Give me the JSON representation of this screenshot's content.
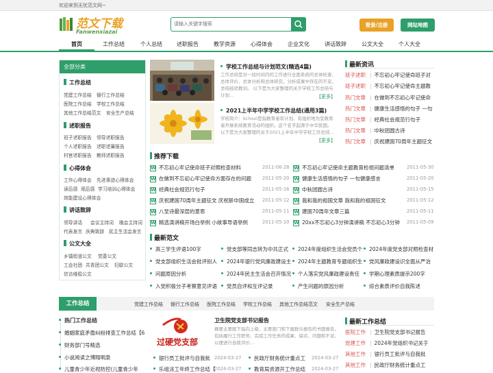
{
  "topbar": {
    "welcome": "欢迎来到无忧范文网~"
  },
  "logo": {
    "cn": "范文下载",
    "en": "Fanwenxiazai"
  },
  "search": {
    "placeholder": "请输入关键字搜索"
  },
  "header": {
    "login": "登录/注册",
    "sitemap": "网站地图"
  },
  "nav": [
    "首页",
    "工作总结",
    "个人总结",
    "述职报告",
    "教学资源",
    "心得体会",
    "企业文化",
    "讲话致辞",
    "公文大全",
    "个人大全"
  ],
  "sidebar": {
    "title": "全部分类",
    "groups": [
      {
        "name": "工作总结",
        "items": [
          [
            "党建工作总结",
            "银行工作总结"
          ],
          [
            "医院工作总结",
            "学校工作总结"
          ],
          [
            "其他工作总结范文",
            "安全生产总结"
          ]
        ]
      },
      {
        "name": "述职报告",
        "items": [
          [
            "班子述职报告",
            "领导述职报告"
          ],
          [
            "个人述职报告",
            "述职述廉报告"
          ],
          [
            "村官述职报告",
            "教师述职报告"
          ]
        ]
      },
      {
        "name": "心得体会",
        "items": [
          [
            "工作心得体会",
            "先进事迹心得体会"
          ],
          [
            "读后感",
            "观后感",
            "学习培训心得体会"
          ],
          [
            "效能建设心得体会"
          ]
        ]
      },
      {
        "name": "讲话致辞",
        "items": [
          [
            "领导讲话",
            "会议主持词",
            "晚会主持词"
          ],
          [
            "代表发言",
            "庆典致辞",
            "民主生活会发言"
          ]
        ]
      },
      {
        "name": "公文大全",
        "items": [
          [
            "乡镇街道公文",
            "党委公文"
          ],
          [
            "工会社团",
            "共青团公文",
            "妇联公文"
          ],
          [
            "信访维稳公文"
          ]
        ]
      }
    ]
  },
  "featured": [
    {
      "title": "学校工作总结与计划范文(精选4篇)",
      "desc": "工作总结是对一段时间内的工作进行全面系统的总体检查、总体评价、总体分析和总体研究，分析成果中存在的不足，总结经验教训。 以下是为大家整理的关于学校工作总结与计划...",
      "more": "【更多】"
    },
    {
      "title": "2021上半年中学学校工作总结(通用3篇)",
      "desc": "学校简介：School是指教育者有计划、有组织地为受教育者开展系统教育活动的组织。这个名字起源于中华民国。 以下是为大家整理的关于2021上半年中学学校工作总结...",
      "more": "【更多】"
    }
  ],
  "latest_news": {
    "title": "最新资讯",
    "items": [
      {
        "tag": "班子述职",
        "title": "不忘初心牢记使命班子对"
      },
      {
        "tag": "班子述职",
        "title": "不忘初心牢记使命主题教"
      },
      {
        "tag": "热门文章",
        "title": "在做到不忘初心牢记使命"
      },
      {
        "tag": "热门文章",
        "title": "健康生活感悟的句子 一句"
      },
      {
        "tag": "热门文章",
        "title": "经典社会规范行句子"
      },
      {
        "tag": "热门文章",
        "title": "中秋团圆古诗"
      },
      {
        "tag": "热门文章",
        "title": "庆祝建国70周年主题征文"
      }
    ]
  },
  "recommended": {
    "title": "推荐下载",
    "items": [
      {
        "title": "不忘初心牢记使命班子对照检查材料",
        "date": "2011-06-28"
      },
      {
        "title": "不忘初心牢记使命主题教育检视问题清单",
        "date": "2011-05-30"
      },
      {
        "title": "在做到不忘初心牢记使命方面存在的问题",
        "date": "2011-05-20"
      },
      {
        "title": "健康生活感悟的句子 一句健康感言",
        "date": "2011-05-20"
      },
      {
        "title": "经典社会规范行句子",
        "date": "2011-05-16"
      },
      {
        "title": "中秋团圆古诗",
        "date": "2011-05-15"
      },
      {
        "title": "庆祝建国70周年主题征文 庆祝新中国成立",
        "date": "2011-05-12"
      },
      {
        "title": "我和我的祖国文章 我和我的祖国征文",
        "date": "2011-05-12"
      },
      {
        "title": "八至诗最深层的意思",
        "date": "2011-05-11"
      },
      {
        "title": "建国70周年文章三篇",
        "date": "2011-05-11"
      },
      {
        "title": "精选演讲稿开场白举例 小故事导语举例",
        "date": "2011-05-10"
      },
      {
        "title": "20xx不忘初心3分钟演讲稿 不忘初心3分钟",
        "date": "2011-05-09"
      }
    ]
  },
  "latest_essays": {
    "title": "最新范文",
    "items": [
      [
        "高三学生评语100字",
        "党支部等同志转为中共正式",
        "2024年度组织生活会党员个",
        "2024年度党支部对照检查材"
      ],
      [
        "党支部组织生活会批评别人",
        "2024年银行党风廉政建设主",
        "2024年主题教育专题组织生",
        "党风廉政建设识全面从严治"
      ],
      [
        "问题原因分析",
        "2024年民主生活会召开情况",
        "个人落实党风廉政建设责任",
        "学期心理素质提示200字"
      ],
      [
        "入党积极分子考察意见评语",
        "党员自评和互评记录",
        "产生问题的原因分析",
        "综合素质评价自我陈述"
      ]
    ]
  },
  "section2": {
    "label": "工作总结",
    "links": [
      "党建工作总结",
      "银行工作总结",
      "医院工作总结",
      "学校工作总结",
      "其他工作总结范文",
      "安全生产总结"
    ]
  },
  "hot_summary": {
    "title": "热门工作总结",
    "items": [
      "婚姻家庭矛盾纠纷排查工作总结【6",
      "财务部门号精选",
      "小说阅读之博翔明泉",
      "儿童青少年近视防控(儿童青少年"
    ]
  },
  "featured2": {
    "title": "卫生院党支部书记报告",
    "desc": "摘要主要股下指向上级、主要部门和下属群众报告的书面报告，包括履行工作职务、完成工作任务的成果、缺点、问题和不足，以便进行自我评价...",
    "image_text": "过硬党支部"
  },
  "bank_list": [
    {
      "title": "银行员工批评与自我批",
      "date": "2024-03-27"
    },
    {
      "title": "民政厅财务统计重点工",
      "date": "2024-03-27"
    },
    {
      "title": "乐组派工年终工作总结【",
      "date": "2024-03-27"
    },
    {
      "title": "教育局资源开工作总结",
      "date": "2024-03-27"
    }
  ],
  "latest_summary": {
    "title": "最新工作总结",
    "items": [
      {
        "tag": "医院工作",
        "title": "卫生院党支部书记报告"
      },
      {
        "tag": "党建工作",
        "title": "2024年党组织书记关于"
      },
      {
        "tag": "其他工作",
        "title": "银行员工批评与自我批"
      },
      {
        "tag": "其他工作",
        "title": "民政厅财务统计重点工"
      }
    ]
  },
  "colors": {
    "primary": "#2e9e6a",
    "orange": "#e9a126",
    "tag": "#d9534f"
  }
}
